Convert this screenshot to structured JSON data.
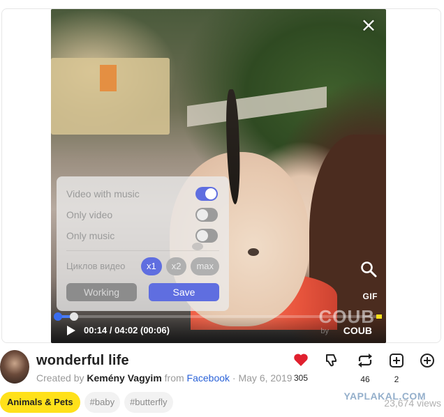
{
  "player": {
    "close_label": "×",
    "settings": {
      "options": [
        {
          "label": "Video with music",
          "on": true
        },
        {
          "label": "Only video",
          "on": false
        },
        {
          "label": "Only music",
          "on": false
        }
      ],
      "loops_label": "Циклов видео",
      "loop_options": [
        "x1",
        "x2",
        "max"
      ],
      "loop_selected": "x1",
      "working_label": "Working",
      "save_label": "Save"
    },
    "gif_label": "GIF",
    "watermark": "COUB",
    "watermark_by": "by",
    "time_current": "00:14",
    "time_total": "04:02",
    "time_clip": "(00:06)",
    "time_separator": "/",
    "brand": "COUB",
    "progress_fraction": 0.058,
    "accent_color": "#5f6ee0"
  },
  "meta": {
    "title": "wonderful life",
    "created_by_prefix": "Created by",
    "author": "Kemény Vagyim",
    "from_word": "from",
    "source": "Facebook",
    "separator": "·",
    "date": "May 6, 2019",
    "actions": [
      {
        "icon": "heart-icon",
        "count": "305",
        "color": "#e0202e"
      },
      {
        "icon": "dislike-icon",
        "count": ""
      },
      {
        "icon": "recoub-icon",
        "count": "46"
      },
      {
        "icon": "add-box-icon",
        "count": "2"
      },
      {
        "icon": "plus-circle-icon",
        "count": ""
      }
    ]
  },
  "tags": [
    "Animals & Pets",
    "#baby",
    "#butterfly"
  ],
  "views": "23,674 views",
  "site_watermark": "YAPLAKAL.COM"
}
